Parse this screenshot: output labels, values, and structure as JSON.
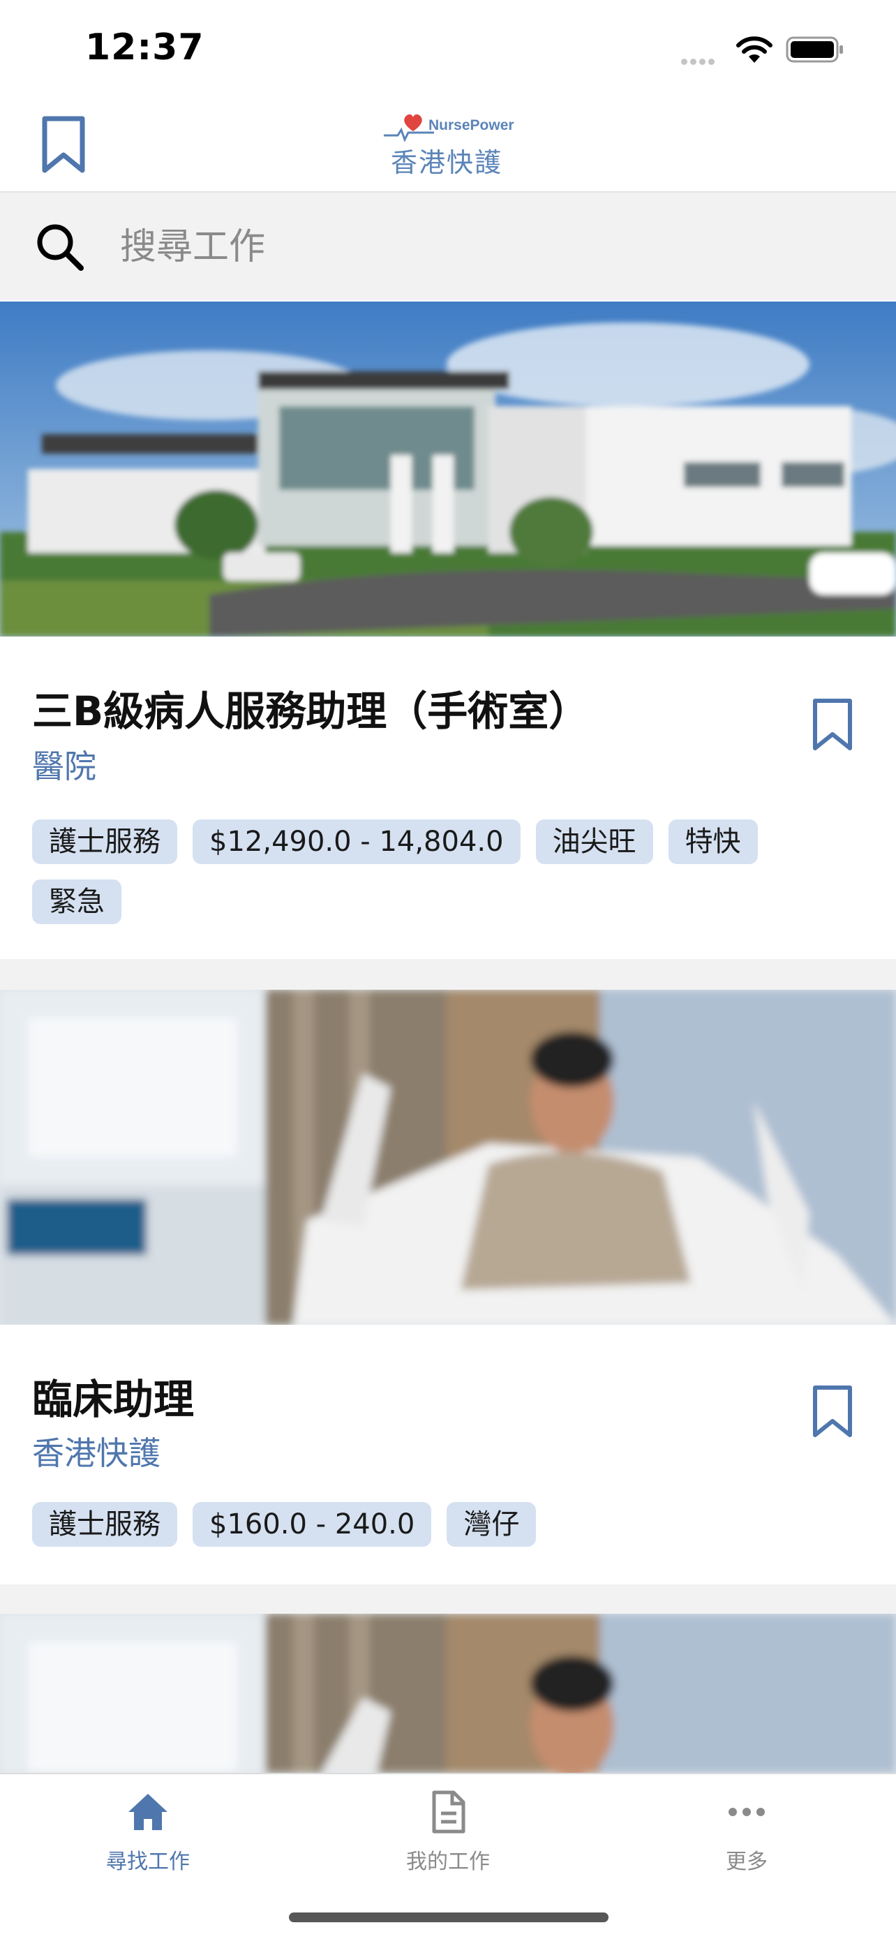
{
  "status_bar": {
    "time": "12:37"
  },
  "header": {
    "logo_brand": "NursePower",
    "logo_name": "香港快護"
  },
  "search": {
    "placeholder": "搜尋工作"
  },
  "jobs": [
    {
      "title": "三B級病人服務助理（手術室）",
      "company": "醫院",
      "image": "hospital-building-photo",
      "tags": [
        "護士服務",
        "$12,490.0 - 14,804.0",
        "油尖旺",
        "特快",
        "緊急"
      ]
    },
    {
      "title": "臨床助理",
      "company": "香港快護",
      "image": "patient-in-bed-photo",
      "tags": [
        "護士服務",
        "$160.0 - 240.0",
        "灣仔"
      ]
    },
    {
      "image": "patient-in-bed-photo"
    }
  ],
  "tab_bar": {
    "tabs": [
      {
        "label": "尋找工作",
        "icon": "home-icon",
        "active": true
      },
      {
        "label": "我的工作",
        "icon": "document-icon",
        "active": false
      },
      {
        "label": "更多",
        "icon": "more-icon",
        "active": false
      }
    ]
  },
  "colors": {
    "accent": "#4f76ad",
    "tag_background": "#d5e1f1",
    "search_background": "#f2f2f2"
  }
}
